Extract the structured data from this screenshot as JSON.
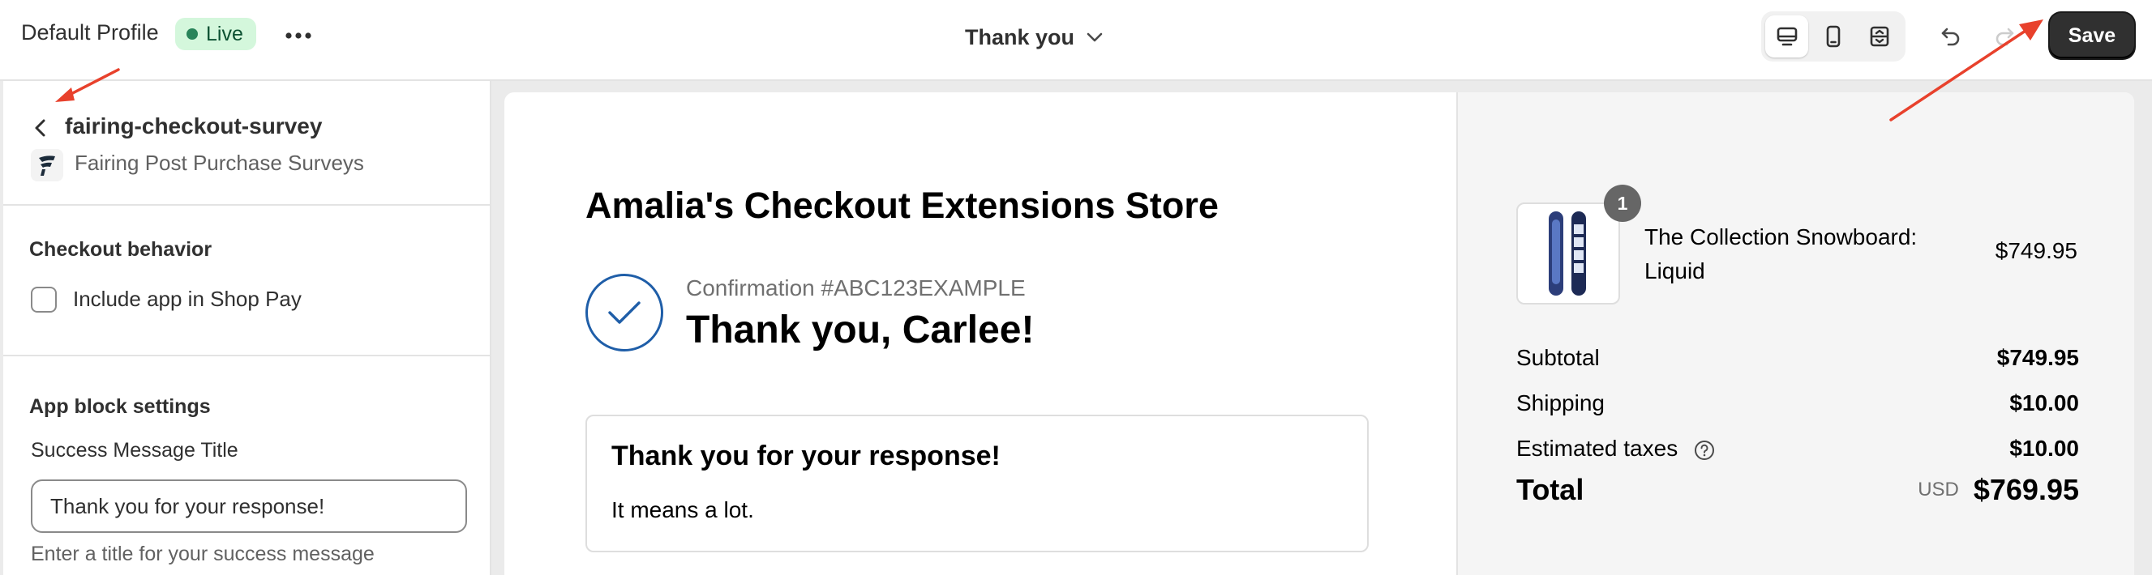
{
  "topbar": {
    "profile_name": "Default Profile",
    "status_badge": "Live",
    "page_selector": "Thank you",
    "save_label": "Save",
    "view_modes": [
      "desktop-icon",
      "mobile-icon",
      "fullscreen-icon"
    ],
    "active_view": "desktop-icon"
  },
  "sidebar": {
    "app_title": "fairing-checkout-survey",
    "app_subtitle": "Fairing Post Purchase Surveys",
    "checkout_behavior": {
      "heading": "Checkout behavior",
      "checkbox_label": "Include app in Shop Pay",
      "checked": false
    },
    "app_block_settings": {
      "heading": "App block settings",
      "field_label": "Success Message Title",
      "field_value": "Thank you for your response!",
      "help_text": "Enter a title for your success message"
    }
  },
  "preview": {
    "store_name": "Amalia's Checkout Extensions Store",
    "confirmation": "Confirmation #ABC123EXAMPLE",
    "thanks_title": "Thank you, Carlee!",
    "response_card": {
      "title": "Thank you for your response!",
      "body": "It means a lot."
    },
    "order": {
      "item": {
        "quantity": "1",
        "name": "The Collection Snowboard: Liquid",
        "price": "$749.95"
      },
      "rows": [
        {
          "label": "Subtotal",
          "value": "$749.95"
        },
        {
          "label": "Shipping",
          "value": "$10.00"
        },
        {
          "label": "Estimated taxes",
          "value": "$10.00"
        }
      ],
      "total_label": "Total",
      "currency": "USD",
      "total_value": "$769.95"
    }
  },
  "colors": {
    "live_bg": "#d4f7dc",
    "live_dot": "#29845a",
    "save_bg": "#303030",
    "annotation_arrow": "#e8412c",
    "check_circle": "#1f5ea8"
  }
}
